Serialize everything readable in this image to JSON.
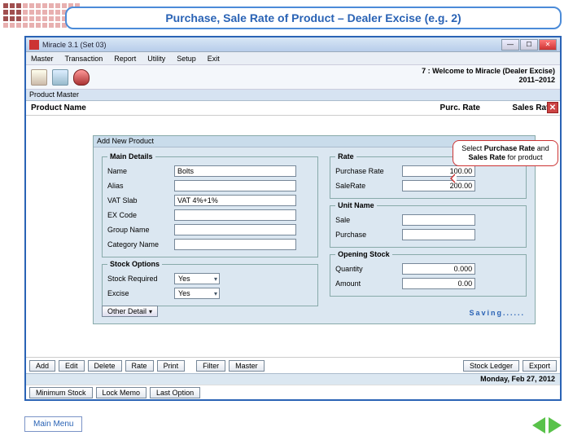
{
  "slide_title": "Purchase, Sale Rate of Product – Dealer Excise (e.g. 2)",
  "window": {
    "title": "Miracle 3.1 (Set 03)",
    "welcome_l1": "7 : Welcome to Miracle (Dealer Excise)",
    "welcome_l2": "2011–2012"
  },
  "menus": [
    "Master",
    "Transaction",
    "Report",
    "Utility",
    "Setup",
    "Exit"
  ],
  "product_master_label": "Product Master",
  "columns": {
    "name": "Product Name",
    "purc": "Purc. Rate",
    "sales": "Sales Rate"
  },
  "popup": {
    "title": "Add New Product",
    "groups": {
      "main": "Main Details",
      "rate": "Rate",
      "unit": "Unit Name",
      "opening": "Opening Stock",
      "stock": "Stock Options"
    },
    "fields": {
      "name": "Name",
      "alias": "Alias",
      "vat_slab": "VAT Slab",
      "ex_code": "EX Code",
      "group": "Group Name",
      "category": "Category Name",
      "purchase_rate": "Purchase Rate",
      "salerate": "SaleRate",
      "sale_unit": "Sale",
      "purchase_unit": "Purchase",
      "quantity": "Quantity",
      "amount": "Amount",
      "stock_required": "Stock Required",
      "excise": "Excise"
    },
    "values": {
      "name": "Bolts",
      "vat_slab": "VAT 4%+1%",
      "purchase_rate": "100.00",
      "salerate": "200.00",
      "quantity": "0.000",
      "amount": "0.00",
      "stock_required": "Yes",
      "excise": "Yes"
    },
    "other_btn": "Other Detail",
    "saving": "Saving......"
  },
  "callout": {
    "l1": "Select ",
    "b1": "Purchase Rate",
    "l2": " and ",
    "b2": "Sales Rate",
    "l3": " for product"
  },
  "bottom_buttons": [
    "Add",
    "Edit",
    "Delete",
    "Rate",
    "Print",
    "Filter",
    "Master",
    "Stock Ledger",
    "Export"
  ],
  "sub_buttons": [
    "Minimum Stock",
    "Lock Memo",
    "Last Option"
  ],
  "date": "Monday, Feb 27, 2012",
  "main_menu": "Main Menu"
}
